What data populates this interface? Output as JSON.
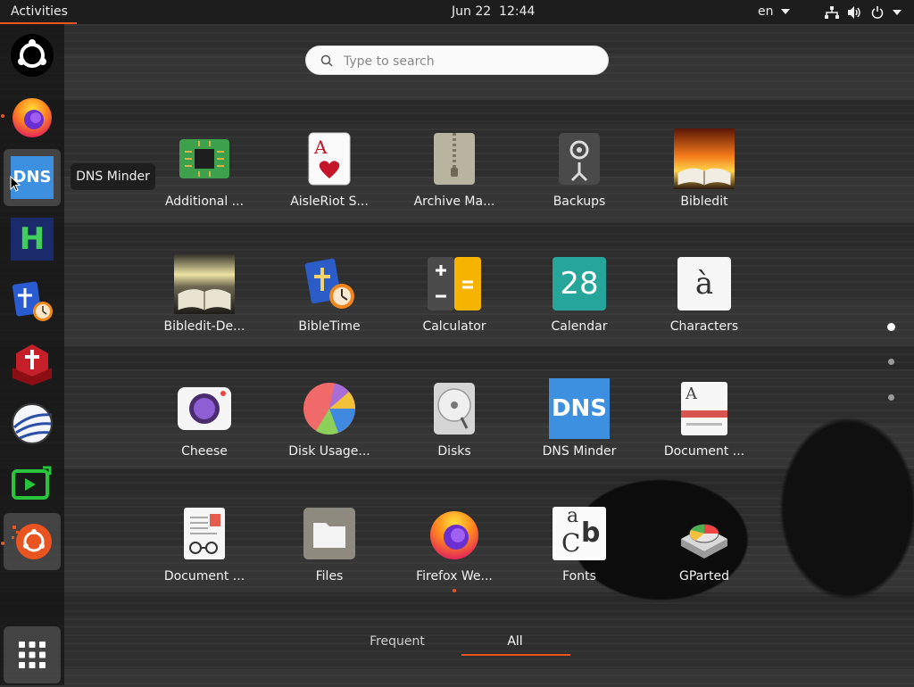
{
  "topbar": {
    "activities_label": "Activities",
    "clock": "Jun 22  12:44",
    "language": "en",
    "tray_icons": [
      "network-icon",
      "volume-icon",
      "power-icon"
    ]
  },
  "dock": {
    "items": [
      {
        "name": "ubuntu-logo-icon"
      },
      {
        "name": "firefox-icon",
        "running": true
      },
      {
        "name": "dns-minder-icon",
        "label": "DNS",
        "active": true
      },
      {
        "name": "h-app-icon",
        "label": "H"
      },
      {
        "name": "bibletime-icon"
      },
      {
        "name": "bible-app-icon"
      },
      {
        "name": "globe-app-icon"
      },
      {
        "name": "screen-share-icon"
      },
      {
        "name": "ubuntu-software-icon",
        "running": true
      }
    ],
    "show_apps_icon": "app-grid-icon",
    "tooltip": "DNS Minder"
  },
  "search": {
    "placeholder": "Type to search"
  },
  "apps": [
    {
      "label": "Additional ...",
      "icon": "chip-icon"
    },
    {
      "label": "AisleRiot S...",
      "icon": "playing-card-icon"
    },
    {
      "label": "Archive Ma...",
      "icon": "archive-icon"
    },
    {
      "label": "Backups",
      "icon": "backup-safe-icon"
    },
    {
      "label": "Bibledit",
      "icon": "bible-sunset-icon"
    },
    {
      "label": "Bibledit-De...",
      "icon": "bible-book-icon"
    },
    {
      "label": "BibleTime",
      "icon": "bibletime-app-icon"
    },
    {
      "label": "Calculator",
      "icon": "calculator-icon"
    },
    {
      "label": "Calendar",
      "icon": "calendar-icon",
      "text": "28"
    },
    {
      "label": "Characters",
      "icon": "characters-icon",
      "text": "à"
    },
    {
      "label": "Cheese",
      "icon": "camera-icon"
    },
    {
      "label": "Disk Usage...",
      "icon": "pie-chart-icon"
    },
    {
      "label": "Disks",
      "icon": "disk-icon"
    },
    {
      "label": "DNS Minder",
      "icon": "dns-icon",
      "text": "DNS"
    },
    {
      "label": "Document ...",
      "icon": "document-viewer-icon",
      "text": "A"
    },
    {
      "label": "Document ...",
      "icon": "document-scanner-icon"
    },
    {
      "label": "Files",
      "icon": "folder-icon"
    },
    {
      "label": "Firefox We...",
      "icon": "firefox-browser-icon",
      "running": true
    },
    {
      "label": "Fonts",
      "icon": "fonts-icon",
      "text_a": "a",
      "text_b": "b",
      "text_c": "C"
    },
    {
      "label": "GParted",
      "icon": "gparted-icon"
    }
  ],
  "pagination": {
    "pages": 3,
    "current": 1
  },
  "tabs": {
    "frequent": "Frequent",
    "all": "All",
    "selected": "All"
  },
  "colors": {
    "accent": "#e95420",
    "dns_blue": "#3d8fe0"
  }
}
